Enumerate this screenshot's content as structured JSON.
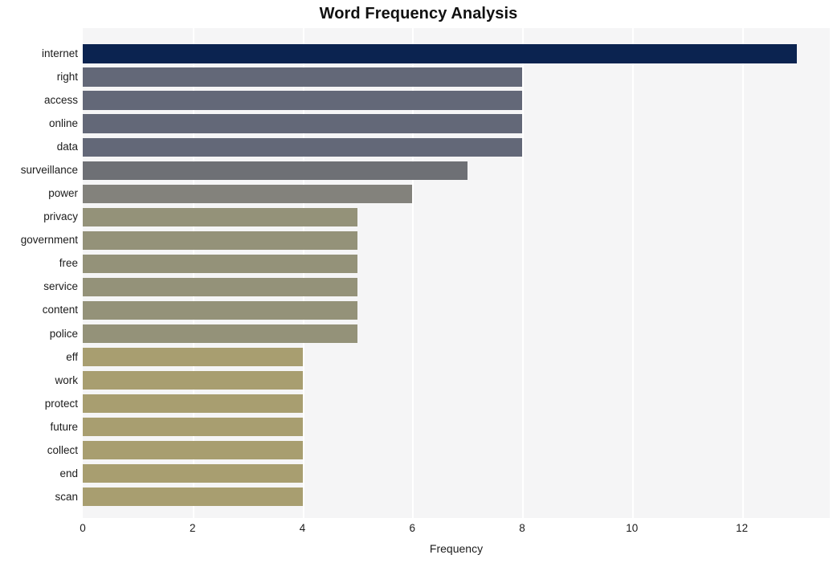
{
  "chart_data": {
    "type": "bar",
    "orientation": "horizontal",
    "title": "Word Frequency Analysis",
    "xlabel": "Frequency",
    "ylabel": "",
    "xlim": [
      0,
      13.6
    ],
    "ylim": [
      0,
      20
    ],
    "grid": true,
    "grid_axis": "x",
    "legend": "none",
    "categories": [
      "internet",
      "right",
      "access",
      "online",
      "data",
      "surveillance",
      "power",
      "privacy",
      "government",
      "free",
      "service",
      "content",
      "police",
      "eff",
      "work",
      "protect",
      "future",
      "collect",
      "end",
      "scan"
    ],
    "values": [
      13,
      8,
      8,
      8,
      8,
      7,
      6,
      5,
      5,
      5,
      5,
      5,
      5,
      4,
      4,
      4,
      4,
      4,
      4,
      4
    ],
    "bar_colors": [
      "#0b2350",
      "#636878",
      "#636878",
      "#636878",
      "#636878",
      "#6e7075",
      "#83827c",
      "#949279",
      "#949279",
      "#949279",
      "#949279",
      "#949279",
      "#949279",
      "#a89e70",
      "#a89e70",
      "#a89e70",
      "#a89e70",
      "#a89e70",
      "#a89e70",
      "#a89e70"
    ],
    "xticks": [
      0,
      2,
      4,
      6,
      8,
      10,
      12
    ],
    "xtick_labels": [
      "0",
      "2",
      "4",
      "6",
      "8",
      "10",
      "12"
    ],
    "plot_background": "#f5f5f6",
    "figure_background": "#ffffff",
    "gridline_color": "#ffffff"
  }
}
